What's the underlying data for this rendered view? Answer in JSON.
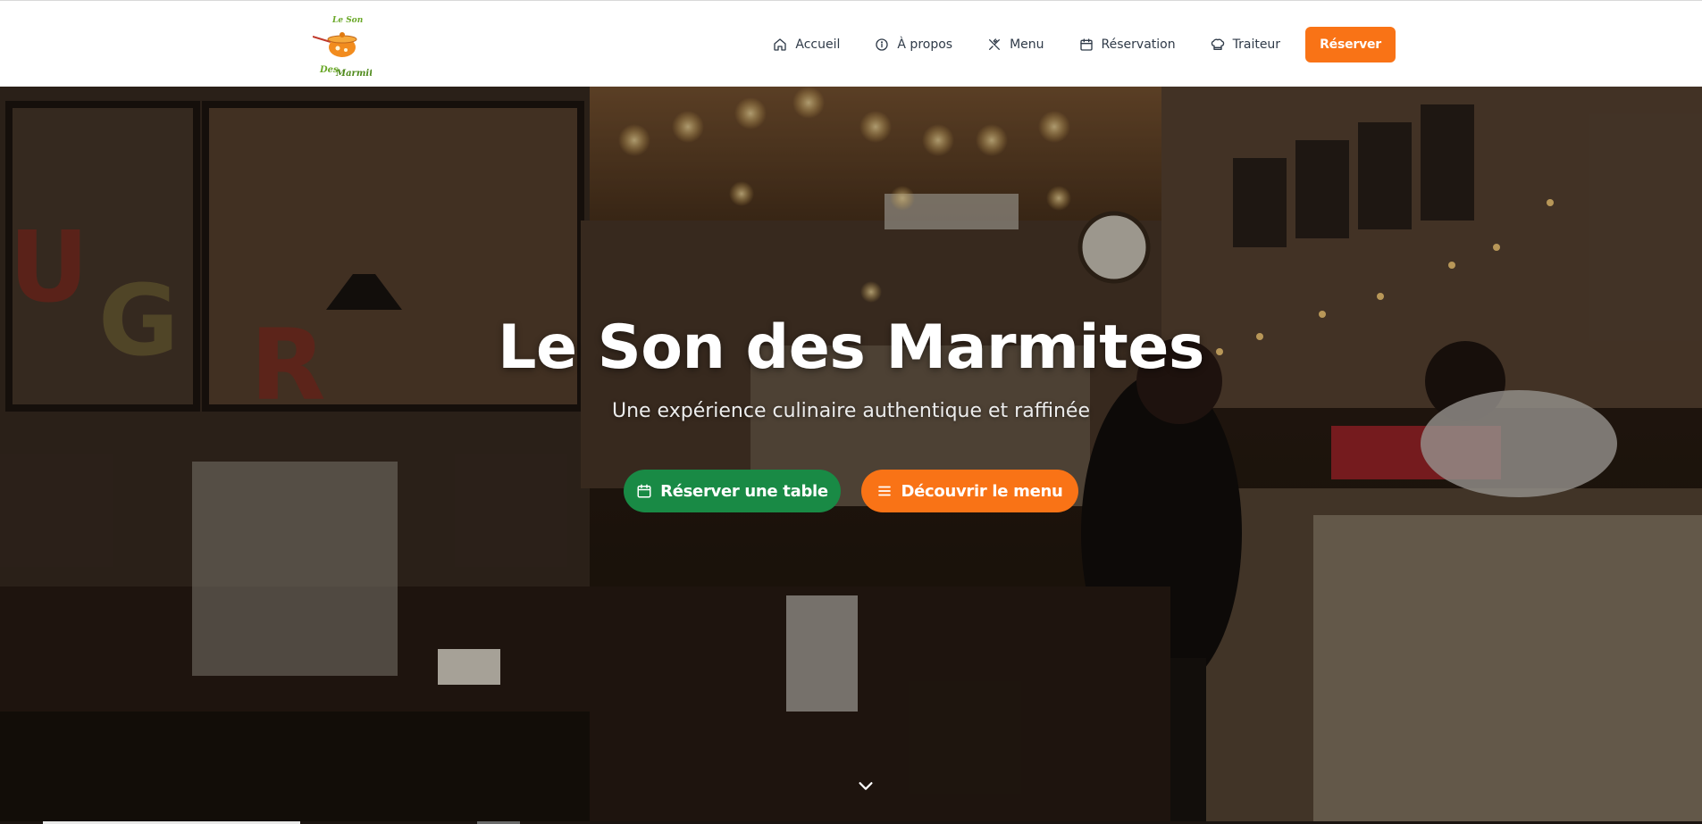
{
  "logo": {
    "alt": "Le Son des Marmites"
  },
  "nav": {
    "items": [
      {
        "label": "Accueil",
        "icon": "home-icon"
      },
      {
        "label": "À propos",
        "icon": "info-icon"
      },
      {
        "label": "Menu",
        "icon": "utensils-icon"
      },
      {
        "label": "Réservation",
        "icon": "calendar-icon"
      },
      {
        "label": "Traiteur",
        "icon": "chef-hat-icon"
      }
    ],
    "cta_label": "Réserver"
  },
  "hero": {
    "title": "Le Son des Marmites",
    "subtitle": "Une expérience culinaire authentique et raffinée",
    "primary_button": "Réserver une table",
    "secondary_button": "Découvrir le menu",
    "scroll_icon": "chevron-down-icon"
  },
  "colors": {
    "accent_orange": "#f97316",
    "accent_green": "#198a45",
    "nav_text": "#2f3a48"
  }
}
